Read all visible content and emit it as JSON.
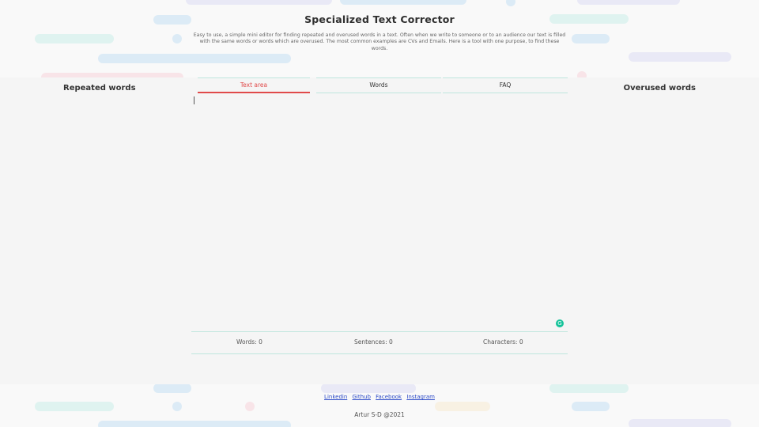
{
  "header": {
    "title": "Specialized Text Corrector",
    "description": "Easy to use, a simple mini editor for finding repeated and overused words in a text. Often when we write to someone or to an audience our text is filled with the same words or words which are overused. The most common examples are CVs and Emails. Here is a tool with one purpose, to find these words."
  },
  "sidebar": {
    "left_title": "Repeated words",
    "right_title": "Overused words"
  },
  "tabs": [
    {
      "label": "Text area",
      "active": true
    },
    {
      "label": "Words",
      "active": false
    },
    {
      "label": "FAQ",
      "active": false
    }
  ],
  "editor": {
    "value": "",
    "grammarly_icon": "G"
  },
  "stats": {
    "words": "Words: 0",
    "sentences": "Sentences: 0",
    "characters": "Characters: 0"
  },
  "footer": {
    "links": [
      "Linkedin",
      "Github",
      "Facebook",
      "Instagram"
    ],
    "copyright": "Artur S-D @2021"
  },
  "colors": {
    "accent": "#e04a4a",
    "divider": "#bfe6de",
    "link": "#2b49c8",
    "grammarly": "#15c39a"
  }
}
